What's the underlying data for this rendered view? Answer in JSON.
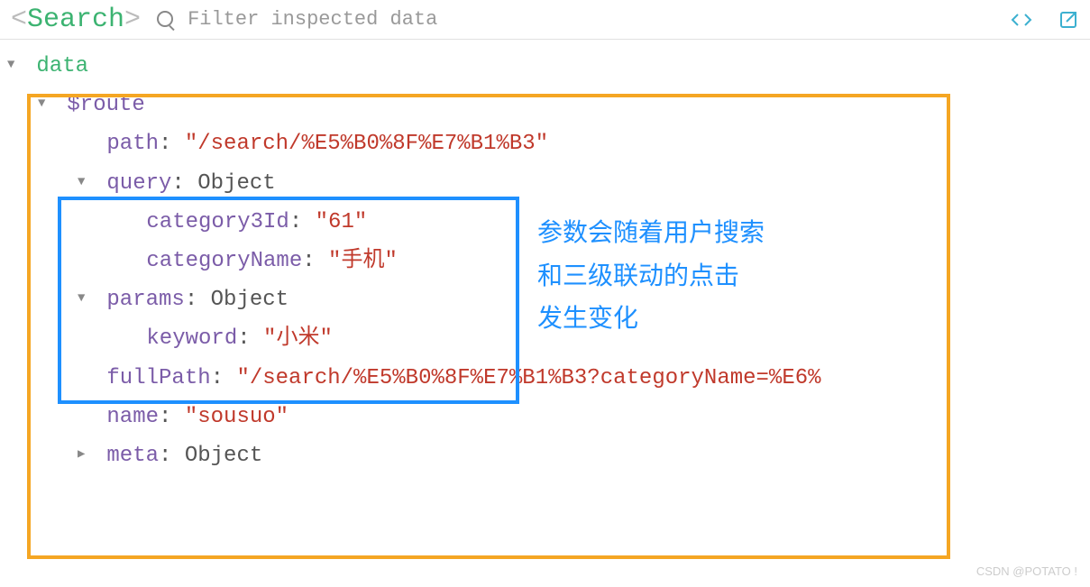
{
  "toolbar": {
    "angle_open": "<",
    "search_label": "Search",
    "angle_close": ">",
    "filter_placeholder": "Filter inspected data",
    "code_btn": "< >",
    "popout_btn": "popout"
  },
  "tree": {
    "root": "data",
    "route_key": "$route",
    "path_key": "path",
    "path_val": "\"/search/%E5%B0%8F%E7%B1%B3\"",
    "query_key": "query",
    "query_type": "Object",
    "category3Id_key": "category3Id",
    "category3Id_val": "\"61\"",
    "categoryName_key": "categoryName",
    "categoryName_val": "\"手机\"",
    "params_key": "params",
    "params_type": "Object",
    "keyword_key": "keyword",
    "keyword_val": "\"小米\"",
    "fullPath_key": "fullPath",
    "fullPath_val": "\"/search/%E5%B0%8F%E7%B1%B3?categoryName=%E6%",
    "name_key": "name",
    "name_val": "\"sousuo\"",
    "meta_key": "meta",
    "meta_type": "Object"
  },
  "annotation": {
    "line1": "参数会随着用户搜索",
    "line2": "和三级联动的点击",
    "line3": "发生变化"
  },
  "watermark": "CSDN @POTATO !"
}
